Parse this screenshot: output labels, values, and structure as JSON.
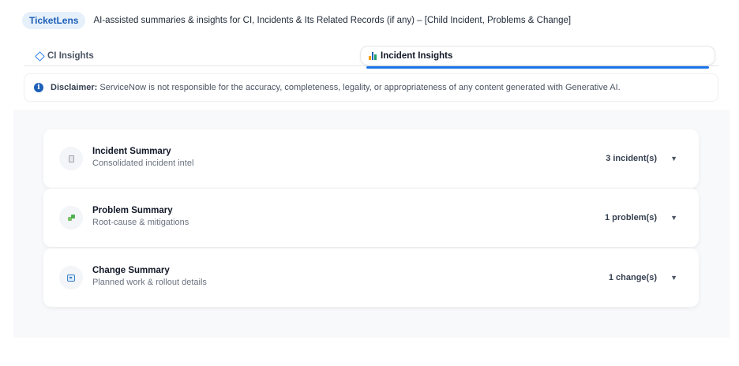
{
  "header": {
    "brand": "TicketLens",
    "description": "AI-assisted summaries & insights for CI, Incidents & Its Related Records (if any) – [Child Incident, Problems & Change]"
  },
  "tabs": [
    {
      "label": "CI Insights",
      "icon": "diamond-icon",
      "active": false
    },
    {
      "label": "Incident Insights",
      "icon": "bar-chart-icon",
      "active": true
    }
  ],
  "disclaimer": {
    "icon": "info-icon",
    "label": "Disclaimer:",
    "text": "ServiceNow is not responsible for the accuracy, completeness, legality, or appropriateness of any content generated with Generative AI."
  },
  "cards": [
    {
      "title": "Incident Summary",
      "subtitle": "Consolidated incident intel",
      "count": "3 incident(s)",
      "icon": "document-icon"
    },
    {
      "title": "Problem Summary",
      "subtitle": "Root-cause & mitigations",
      "count": "1 problem(s)",
      "icon": "puzzle-icon"
    },
    {
      "title": "Change Summary",
      "subtitle": "Planned work & rollout details",
      "count": "1 change(s)",
      "icon": "change-icon"
    }
  ],
  "chevron": "▼",
  "colors": {
    "accent": "#1a73e8",
    "brand_pill_bg": "#e6f0fb",
    "brand_text": "#1c5fb8"
  }
}
